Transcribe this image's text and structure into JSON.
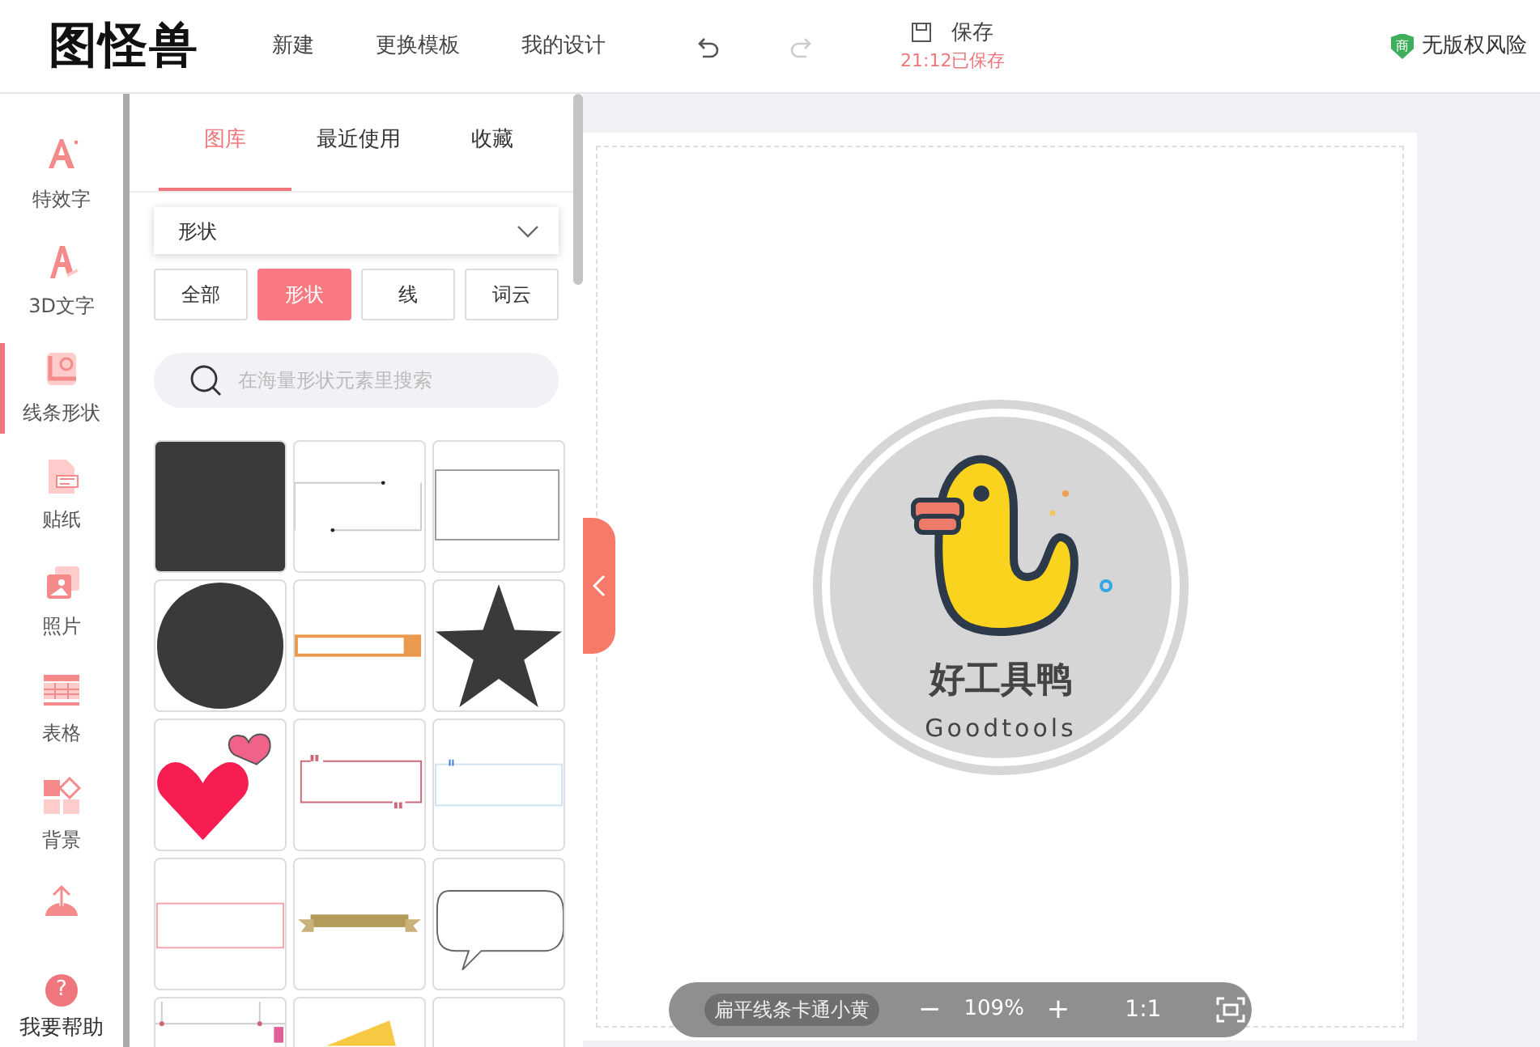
{
  "header": {
    "logo": "图怪兽",
    "nav": [
      "新建",
      "更换模板",
      "我的设计"
    ],
    "undo": {
      "disabled": false
    },
    "redo": {
      "disabled": true
    },
    "save": {
      "label": "保存",
      "status": "21:12已保存"
    },
    "copyright": {
      "badge": "商",
      "label": "无版权风险"
    }
  },
  "sidebar": {
    "items": [
      {
        "kind": "effect-text",
        "label": "特效字",
        "selected": false
      },
      {
        "kind": "text-3d",
        "label": "3D文字",
        "selected": false
      },
      {
        "kind": "shape",
        "label": "线条形状",
        "selected": true
      },
      {
        "kind": "sticker",
        "label": "贴纸",
        "selected": false
      },
      {
        "kind": "photo",
        "label": "照片",
        "selected": false
      },
      {
        "kind": "table",
        "label": "表格",
        "selected": false
      },
      {
        "kind": "background",
        "label": "背景",
        "selected": false
      },
      {
        "kind": "upload",
        "selected": false
      }
    ],
    "help": {
      "icon": "?",
      "label": "我要帮助"
    }
  },
  "panel": {
    "tabs": [
      {
        "label": "图库",
        "selected": true
      },
      {
        "label": "最近使用",
        "selected": false
      },
      {
        "label": "收藏",
        "selected": false
      }
    ],
    "dropdown": "形状",
    "filters": [
      {
        "label": "全部",
        "selected": false
      },
      {
        "label": "形状",
        "selected": true
      },
      {
        "label": "线",
        "selected": false
      },
      {
        "label": "词云",
        "selected": false
      }
    ],
    "search": {
      "placeholder": "在海量形状元素里搜索"
    },
    "tiles": [
      {
        "kind": "square"
      },
      {
        "kind": "line-frame"
      },
      {
        "kind": "rect-frame"
      },
      {
        "kind": "circle"
      },
      {
        "kind": "bar-frame"
      },
      {
        "kind": "star"
      },
      {
        "kind": "hearts"
      },
      {
        "kind": "quote-frame"
      },
      {
        "kind": "thin-frame"
      },
      {
        "kind": "wide-frame"
      },
      {
        "kind": "ribbon"
      },
      {
        "kind": "speech-bubble"
      },
      {
        "kind": "pin-frame"
      },
      {
        "kind": "note"
      },
      {
        "kind": "blank"
      }
    ]
  },
  "canvas": {
    "logo_title": "好工具鸭",
    "logo_subtitle": "Goodtools"
  },
  "zoom_bar": {
    "template_name": "扁平线条卡通小黄",
    "zoom_out": "−",
    "zoom": "109%",
    "zoom_in": "+",
    "actual_size": "1:1"
  }
}
